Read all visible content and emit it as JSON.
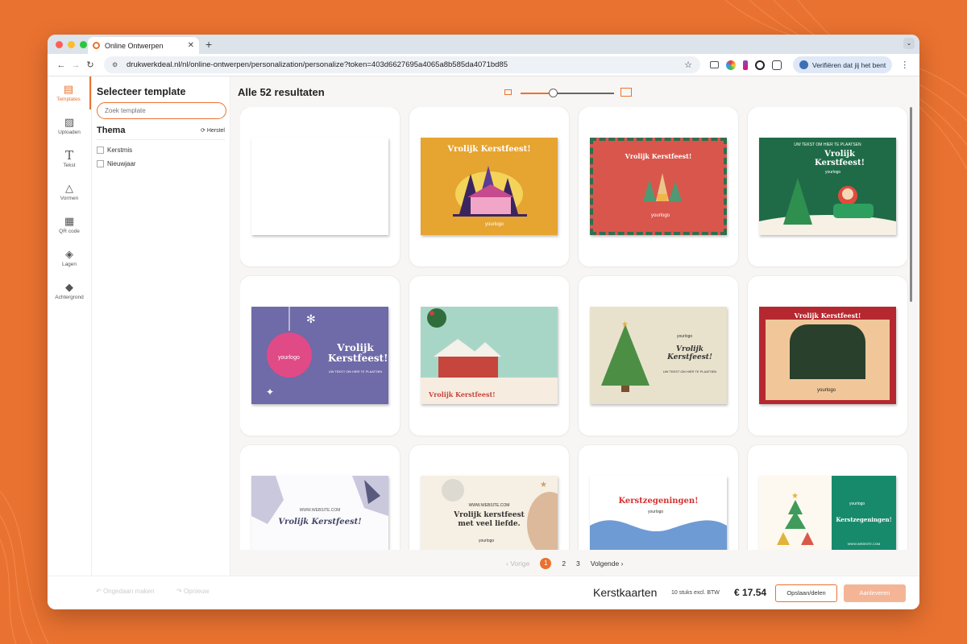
{
  "browser": {
    "tab_title": "Online Ontwerpen",
    "url": "drukwerkdeal.nl/nl/online-ontwerpen/personalization/personalize?token=403d6627695a4065a8b585da4071bd85",
    "verify_label": "Verifiëren dat jij het bent"
  },
  "sidebar": {
    "items": [
      {
        "label": "Templates",
        "icon": "templates-icon"
      },
      {
        "label": "Uploaden",
        "icon": "image-icon"
      },
      {
        "label": "Tekst",
        "icon": "text-icon"
      },
      {
        "label": "Vormen",
        "icon": "shapes-icon"
      },
      {
        "label": "QR code",
        "icon": "qr-icon"
      },
      {
        "label": "Lagen",
        "icon": "layers-icon"
      },
      {
        "label": "Achtergrond",
        "icon": "paint-bucket-icon"
      }
    ]
  },
  "panel": {
    "title": "Selecteer template",
    "search_placeholder": "Zoek template",
    "theme_title": "Thema",
    "reset_label": "Herstel",
    "themes": [
      "Kerstmis",
      "Nieuwjaar"
    ]
  },
  "main": {
    "results_title": "Alle 52 resultaten",
    "zoom_level": 0.35,
    "cards": [
      {
        "style": "blank",
        "texts": []
      },
      {
        "style": "orange-house",
        "texts": [
          "Vrolijk Kerstfeest!",
          "yourlogo"
        ]
      },
      {
        "style": "red-stamp",
        "texts": [
          "Vrolijk Kerstfeest!",
          "yourlogo"
        ]
      },
      {
        "style": "green-santa",
        "texts": [
          "UW TEKST OM HIER TE PLAATSEN",
          "Vrolijk Kerstfeest!",
          "yourlogo"
        ]
      },
      {
        "style": "purple-bauble",
        "texts": [
          "yourlogo",
          "Vrolijk Kerstfeest!",
          "UW TEKST OM HIER TE PLAATSEN"
        ]
      },
      {
        "style": "mint-house",
        "texts": [
          "Vrolijk Kerstfeest!"
        ]
      },
      {
        "style": "beige-tree",
        "texts": [
          "yourlogo",
          "Vrolijk Kerstfeest!",
          "UW TEKST OM HIER TE PLAATSEN"
        ]
      },
      {
        "style": "red-window",
        "texts": [
          "Vrolijk Kerstfeest!",
          "yourlogo"
        ]
      },
      {
        "style": "ink-leaves",
        "texts": [
          "WWW.WEBSITE.COM",
          "Vrolijk Kerstfeest!"
        ]
      },
      {
        "style": "cream-pastel",
        "texts": [
          "WWW.WEBSITE.COM",
          "Vrolijk kerstfeest met veel liefde.",
          "yourlogo"
        ]
      },
      {
        "style": "blue-wave",
        "texts": [
          "Kerstzegeningen!",
          "yourlogo"
        ]
      },
      {
        "style": "teal-trees",
        "texts": [
          "yourlogo",
          "Kerstzegeningen!",
          "WWW.WEBSITE.COM"
        ]
      }
    ]
  },
  "pagination": {
    "prev": "Vorige",
    "pages": [
      "1",
      "2",
      "3"
    ],
    "current": "1",
    "next": "Volgende"
  },
  "footer": {
    "undo": "Ongedaan maken",
    "redo": "Opnieuw",
    "product": "Kerstkaarten",
    "quantity": "10 stuks excl. BTW",
    "price": "€ 17.54",
    "save": "Opslaan/delen",
    "deliver": "Aanleveren"
  },
  "colors": {
    "accent": "#ea7230",
    "background": "#ea7230"
  }
}
